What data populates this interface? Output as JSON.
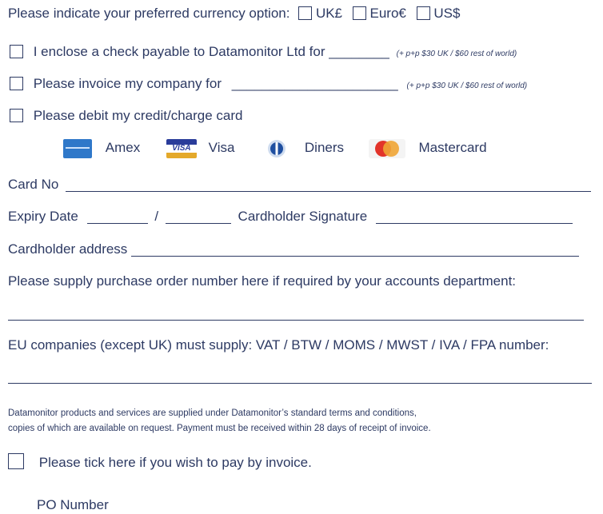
{
  "currency": {
    "prompt": "Please indicate your preferred currency option:",
    "options": [
      "UK£",
      "Euro€",
      "US$"
    ]
  },
  "payment": {
    "check_label": "I enclose a check payable to Datamonitor Ltd for",
    "check_blank": "________",
    "check_note": "(+ p+p $30 UK / $60 rest of world)",
    "invoice_label": "Please invoice my company for",
    "invoice_blank": "______________________",
    "invoice_note": "(+ p+p $30 UK / $60 rest of world)",
    "card_label": "Please debit my credit/charge card"
  },
  "cards": [
    {
      "icon": "amex-logo-icon",
      "label": "Amex"
    },
    {
      "icon": "visa-logo-icon",
      "label": "Visa"
    },
    {
      "icon": "diners-logo-icon",
      "label": "Diners"
    },
    {
      "icon": "mastercard-logo-icon",
      "label": "Mastercard"
    }
  ],
  "fields": {
    "card_no": "Card No",
    "expiry": "Expiry Date",
    "slash": "/",
    "signature": "Cardholder Signature",
    "address": "Cardholder address",
    "po_prompt": "Please supply purchase order number here if required by your accounts department:",
    "vat_prompt": "EU companies (except UK) must supply: VAT / BTW / MOMS / MWST / IVA / FPA number:"
  },
  "terms": {
    "line1": "Datamonitor products and services are supplied under Datamonitor’s standard terms and conditions,",
    "line2": "copies of which are available on request. Payment must be received within 28 days of receipt of invoice."
  },
  "invoice_tick": "Please tick here if you wish to pay by invoice.",
  "po_number_label": "PO Number",
  "colors": {
    "text": "#2d3a63",
    "amex": "#2f78c9",
    "mastercard_red": "#e2342a",
    "mastercard_orange": "#f0a535"
  }
}
